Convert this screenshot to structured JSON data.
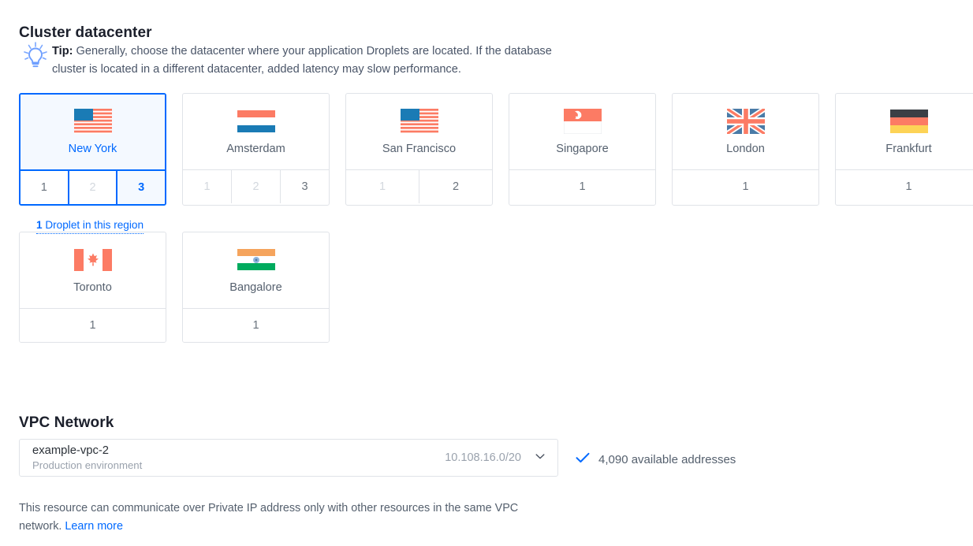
{
  "datacenter": {
    "title": "Cluster datacenter",
    "tip_label": "Tip:",
    "tip_text": "Generally, choose the datacenter where your application Droplets are located. If the database cluster is located in a different datacenter, added latency may slow performance.",
    "tip_icon": "lightbulb-icon",
    "droplet_note_count": "1",
    "droplet_note_text": " Droplet in this region",
    "regions": [
      {
        "name": "New York",
        "flag": "us-flag",
        "selected": true,
        "options": [
          {
            "label": "1",
            "state": "enabled"
          },
          {
            "label": "2",
            "state": "disabled"
          },
          {
            "label": "3",
            "state": "active"
          }
        ]
      },
      {
        "name": "Amsterdam",
        "flag": "nl-flag",
        "selected": false,
        "options": [
          {
            "label": "1",
            "state": "disabled"
          },
          {
            "label": "2",
            "state": "disabled"
          },
          {
            "label": "3",
            "state": "enabled"
          }
        ]
      },
      {
        "name": "San Francisco",
        "flag": "us-flag",
        "selected": false,
        "options": [
          {
            "label": "1",
            "state": "disabled"
          },
          {
            "label": "2",
            "state": "enabled"
          }
        ]
      },
      {
        "name": "Singapore",
        "flag": "sg-flag",
        "selected": false,
        "options": [
          {
            "label": "1",
            "state": "enabled"
          }
        ]
      },
      {
        "name": "London",
        "flag": "gb-flag",
        "selected": false,
        "options": [
          {
            "label": "1",
            "state": "enabled"
          }
        ]
      },
      {
        "name": "Frankfurt",
        "flag": "de-flag",
        "selected": false,
        "options": [
          {
            "label": "1",
            "state": "enabled"
          }
        ]
      },
      {
        "name": "Toronto",
        "flag": "ca-flag",
        "selected": false,
        "options": [
          {
            "label": "1",
            "state": "enabled"
          }
        ]
      },
      {
        "name": "Bangalore",
        "flag": "in-flag",
        "selected": false,
        "options": [
          {
            "label": "1",
            "state": "enabled"
          }
        ]
      }
    ]
  },
  "vpc": {
    "title": "VPC Network",
    "selected_name": "example-vpc-2",
    "selected_description": "Production environment",
    "selected_cidr": "10.108.16.0/20",
    "chevron_icon": "chevron-down-icon",
    "check_icon": "check-icon",
    "available_addresses": "4,090 available addresses",
    "footnote_text": "This resource can communicate over Private IP address only with other resources in the same VPC network. ",
    "footnote_link": "Learn more"
  },
  "colors": {
    "accent": "#0069ff",
    "coral": "#fc7b64",
    "border": "#e0e3e8",
    "text": "#55606e",
    "muted": "#9aa2ad"
  }
}
